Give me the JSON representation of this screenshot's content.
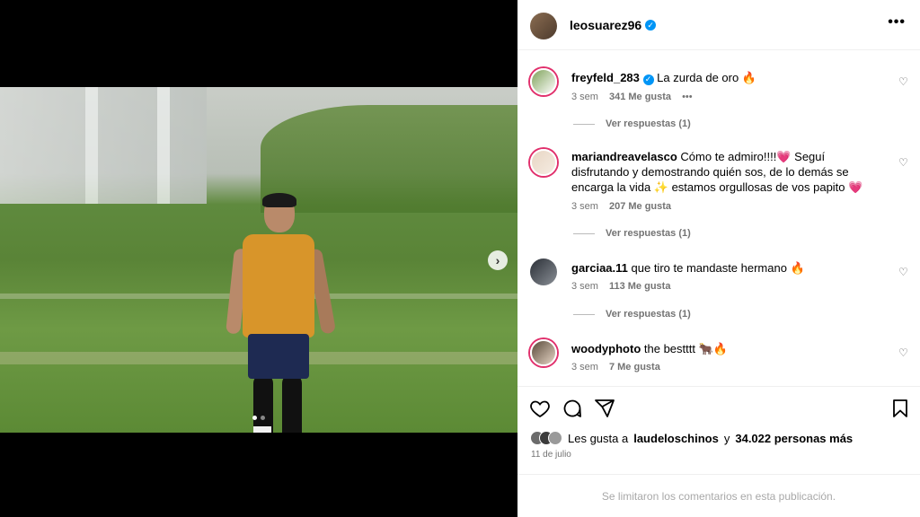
{
  "post": {
    "author": "leosuarez96",
    "more_glyph": "•••",
    "photo_alt": "player on pitch with ball",
    "next_glyph": "›"
  },
  "comments": [
    {
      "user": "freyfeld_283",
      "verified": true,
      "text": "La zurda de oro 🔥",
      "time": "3 sem",
      "likes": "341 Me gusta",
      "extra": "•••",
      "replies": "Ver respuestas (1)"
    },
    {
      "user": "mariandreavelasco",
      "verified": false,
      "text": "Cómo te admiro!!!!💗 Seguí disfrutando y demostrando quién sos, de lo demás se encarga la vida ✨ estamos orgullosas de vos papito 💗",
      "time": "3 sem",
      "likes": "207 Me gusta",
      "replies": "Ver respuestas (1)"
    },
    {
      "user": "garciaa.11",
      "verified": false,
      "text": "que tiro te mandaste hermano 🔥",
      "time": "3 sem",
      "likes": "113 Me gusta",
      "replies": "Ver respuestas (1)"
    },
    {
      "user": "woodyphoto",
      "verified": false,
      "text": "the bestttt 🐂🔥",
      "time": "3 sem",
      "likes": "7 Me gusta"
    }
  ],
  "likes_summary": {
    "prefix": "Les gusta a",
    "user": "laudeloschinos",
    "middle": "y",
    "count": "34.022 personas más"
  },
  "date": "11 de julio",
  "limited_notice": "Se limitaron los comentarios en esta publicación.",
  "verified_glyph": "✓",
  "heart_glyph": "♡"
}
